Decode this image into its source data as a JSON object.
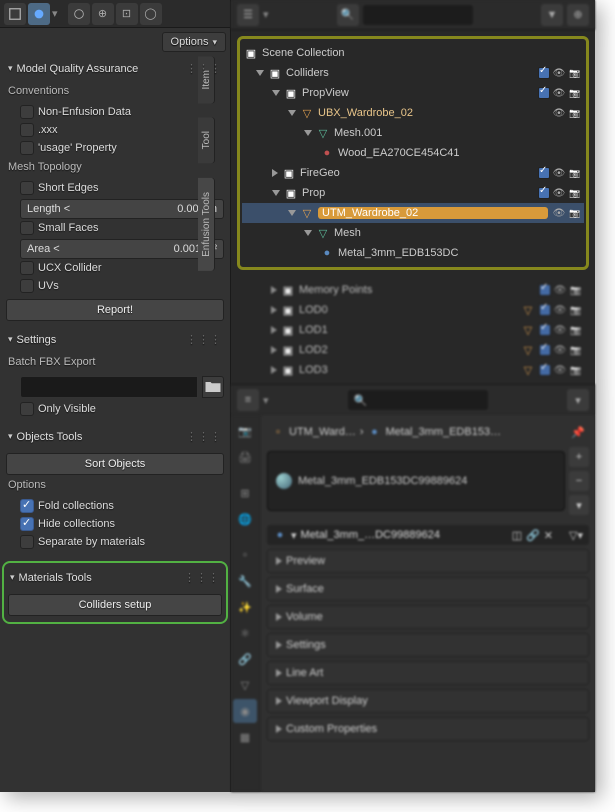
{
  "toolbar": {
    "options_label": "Options"
  },
  "mqa": {
    "title": "Model Quality Assurance",
    "conventions": "Conventions",
    "non_enfusion": "Non-Enfusion Data",
    "xxx": ".xxx",
    "usage": "'usage' Property",
    "mesh_topology": "Mesh Topology",
    "short_edges": "Short Edges",
    "length_label": "Length <",
    "length_val": "0.001 m",
    "small_faces": "Small Faces",
    "area_label": "Area <",
    "area_val": "0.001 m²",
    "ucx": "UCX Collider",
    "uvs": "UVs",
    "report": "Report!"
  },
  "settings": {
    "title": "Settings",
    "batch": "Batch FBX Export",
    "only_visible": "Only Visible"
  },
  "objects_tools": {
    "title": "Objects Tools",
    "sort": "Sort Objects",
    "options": "Options",
    "fold": "Fold collections",
    "hide": "Hide collections",
    "separate": "Separate by materials"
  },
  "materials_tools": {
    "title": "Materials Tools",
    "colliders_setup": "Colliders setup"
  },
  "side_tabs": {
    "item": "Item",
    "tool": "Tool",
    "enfusion": "Enfusion Tools"
  },
  "outliner": {
    "scene_collection": "Scene Collection",
    "colliders": "Colliders",
    "propview": "PropView",
    "ubx": "UBX_Wardrobe_02",
    "mesh001": "Mesh.001",
    "wood_mat": "Wood_EA270CE454C41",
    "firegeo": "FireGeo",
    "prop": "Prop",
    "utm": "UTM_Wardrobe_02",
    "mesh": "Mesh",
    "metal_mat": "Metal_3mm_EDB153DC",
    "memory_points": "Memory Points",
    "lod0": "LOD0",
    "lod1": "LOD1",
    "lod2": "LOD2",
    "lod3": "LOD3"
  },
  "properties": {
    "crumb_obj": "UTM_Ward…",
    "crumb_mat": "Metal_3mm_EDB153…",
    "slot_name": "Metal_3mm_EDB153DC99889624",
    "mat_name": "Metal_3mm_…DC99889624",
    "panels": {
      "preview": "Preview",
      "surface": "Surface",
      "volume": "Volume",
      "settings": "Settings",
      "lineart": "Line Art",
      "viewport": "Viewport Display",
      "custom": "Custom Properties"
    }
  }
}
